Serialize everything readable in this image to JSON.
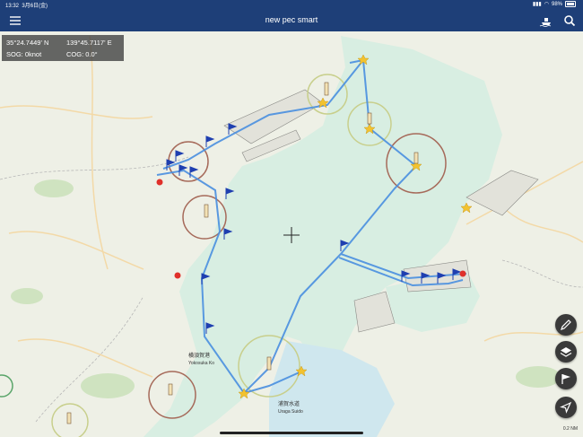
{
  "status_bar": {
    "time": "13:32",
    "date": "3月6日(金)",
    "battery": "98%"
  },
  "nav": {
    "title": "new pec smart",
    "menu_icon": "menu-icon",
    "ship_icon": "ship-icon",
    "search_icon": "search-icon"
  },
  "position": {
    "latitude": "35°24.7449' N",
    "longitude": "139°45.7117' E",
    "sog": "SOG: 0knot",
    "cog": "COG: 0.0°"
  },
  "map_labels": {
    "yokosuka": "横須賀港",
    "yokosuka_en": "Yokosuka Ko",
    "uraga": "浦賀水道",
    "uraga_en": "Uraga Suido"
  },
  "buttons": {
    "draw": "pencil-icon",
    "layers": "layers-icon",
    "route": "flag-icon",
    "locate": "location-arrow-icon"
  },
  "scale_text": "0.2 NM",
  "colors": {
    "nav_bar": "#1e3f78",
    "route": "#4a8fe0",
    "flag": "#1f3fb0",
    "waypoint": "#f2c230",
    "sea": "#d9efe4"
  }
}
